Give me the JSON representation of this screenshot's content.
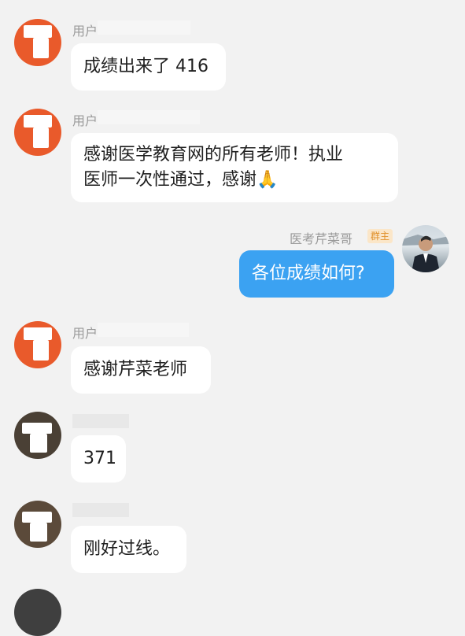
{
  "messages": [
    {
      "sender": "用户",
      "sender_suffix": "5027430000",
      "text": "成绩出来了 416"
    },
    {
      "sender": "用户",
      "sender_suffix": "5027430060",
      "text_line1": "感谢医学教育网的所有老师！执业",
      "text_line2": "医师一次性通过，感谢🙏"
    },
    {
      "sender": "医考芹菜哥",
      "badge": "群主",
      "text": "各位成绩如何?"
    },
    {
      "sender": "用户",
      "text": "感谢芹菜老师"
    },
    {
      "text": "371"
    },
    {
      "text": "刚好过线。"
    }
  ]
}
